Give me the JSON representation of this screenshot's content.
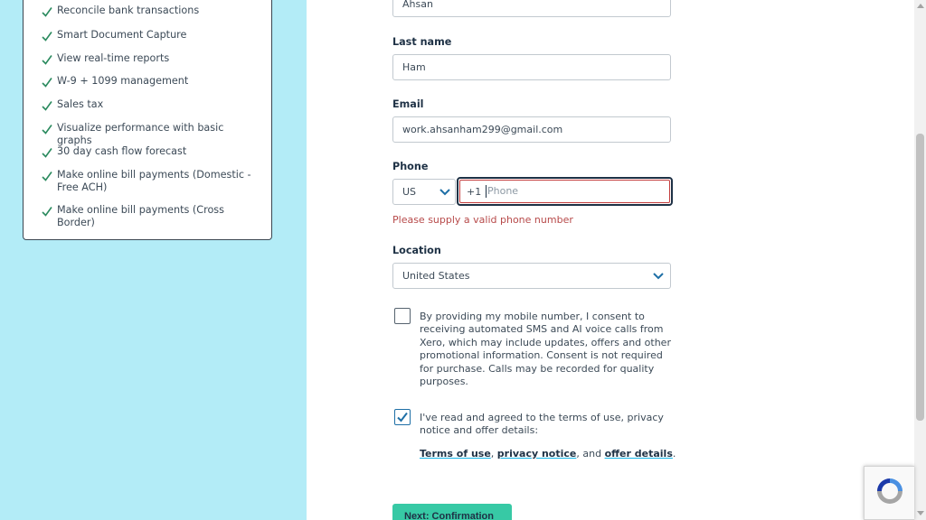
{
  "features": [
    {
      "text": "Reconcile bank transactions"
    },
    {
      "text": "Smart Document Capture"
    },
    {
      "text": "View real-time reports"
    },
    {
      "text": "W-9 + 1099 management"
    },
    {
      "text": "Sales tax"
    },
    {
      "text": "Visualize performance with basic graphs"
    },
    {
      "text": "30 day cash flow forecast"
    },
    {
      "text": "Make online bill payments (Domestic - Free ACH)"
    },
    {
      "text": "Make online bill payments (Cross Border)"
    }
  ],
  "form": {
    "first_name": {
      "value": "Ahsan"
    },
    "last_name": {
      "label": "Last name",
      "value": "Ham"
    },
    "email": {
      "label": "Email",
      "value": "work.ahsanham299@gmail.com"
    },
    "phone": {
      "label": "Phone",
      "country": "US",
      "prefix": "+1",
      "placeholder": "Phone",
      "value": "",
      "error": "Please supply a valid phone number"
    },
    "location": {
      "label": "Location",
      "value": "United States"
    },
    "sms_consent": {
      "checked": false,
      "text": "By providing my mobile number, I consent to receiving automated SMS and AI voice calls from Xero, which may include updates, offers and other promotional information. Consent is not required for purchase. Calls may be recorded for quality purposes."
    },
    "terms_consent": {
      "checked": true,
      "text": "I've read and agreed to the terms of use, privacy notice and offer details:",
      "link_terms": "Terms of use",
      "link_privacy": "privacy notice",
      "link_offer": "offer details",
      "sep1": ",",
      "sep2": ", and",
      "end": "."
    },
    "next_button": "Next: Confirmation"
  },
  "colors": {
    "left_panel_bg": "#b3ecf7",
    "check_green": "#2a8a5e",
    "error_red": "#b74a4a",
    "button_bg": "#37c9a5",
    "link_underline": "#13b5ea"
  },
  "icons": [
    "check-icon",
    "chevron-down-icon",
    "checkmark-icon",
    "recaptcha-icon"
  ]
}
